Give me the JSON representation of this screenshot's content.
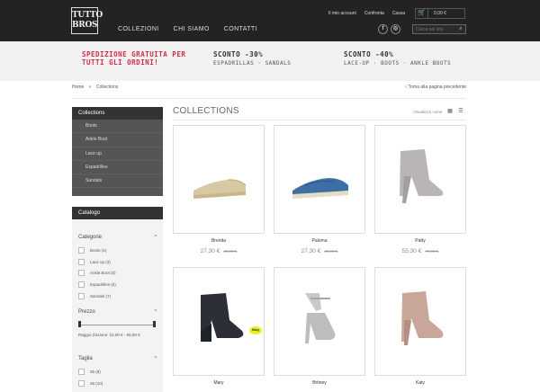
{
  "header": {
    "logo_line1": "TUTTO",
    "logo_line2": "BROS",
    "nav": [
      "COLLEZIONI",
      "CHI SIAMO",
      "CONTATTI"
    ],
    "top_links": [
      "Il mio account",
      "Confronta",
      "Cassa"
    ],
    "cart_total": "0,00 €",
    "social": [
      "f",
      "◎"
    ],
    "search_placeholder": "Cerca nel sito"
  },
  "promo": {
    "left_line1": "SPEDIZIONE GRATUITA PER",
    "left_line2": "TUTTI GLI ORDINI!",
    "mid_title": "SCONTO -30%",
    "mid_sub": "ESPADRILLAS · SANDALS",
    "right_title": "SCONTO -40%",
    "right_sub": "LACE-UP · BOOTS · ANKLE BOOTS"
  },
  "breadcrumb": {
    "home": "Home",
    "current": "Collections",
    "back": "Torna alla pagina precedente"
  },
  "sidebar": {
    "collections_title": "Collections",
    "collections": [
      "Boots",
      "Ankle Boot",
      "Lace up",
      "Espadrilles",
      "Sandals"
    ],
    "catalog_title": "Catalogo",
    "categories_title": "Categorie",
    "categories": [
      "Boots (1)",
      "Lace up (3)",
      "Ankle Boot (5)",
      "Espadrilles (5)",
      "Sandals (7)"
    ],
    "price_title": "Prezzo",
    "price_range": "Raggio d'azione: 22,00 € - 65,00 €",
    "size_title": "Taglia",
    "sizes": [
      "35 (8)",
      "36 (10)"
    ]
  },
  "main": {
    "title": "COLLECTIONS",
    "view_label": "Visualizza come",
    "products": [
      {
        "name": "Brenda",
        "price": "27,30 €",
        "old_price": "39,00 €",
        "badge": ""
      },
      {
        "name": "Paloma",
        "price": "27,30 €",
        "old_price": "39,00 €",
        "badge": ""
      },
      {
        "name": "Patty",
        "price": "55,30 €",
        "old_price": "79,00 €",
        "badge": ""
      },
      {
        "name": "Mary",
        "price": "",
        "old_price": "",
        "badge": "Mary"
      },
      {
        "name": "Britney",
        "price": "",
        "old_price": "",
        "badge": ""
      },
      {
        "name": "Katy",
        "price": "",
        "old_price": "",
        "badge": ""
      }
    ]
  },
  "colors": {
    "header_bg": "#232323",
    "promo_accent": "#d52a4a",
    "sidebar_dark": "#333333",
    "sidebar_list": "#555555"
  }
}
